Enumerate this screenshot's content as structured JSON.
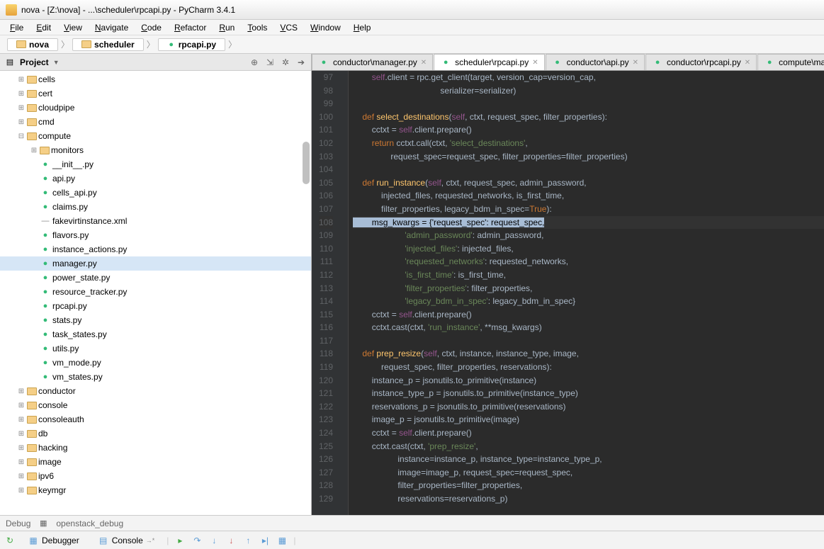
{
  "title": "nova - [Z:\\nova] - ...\\scheduler\\rpcapi.py - PyCharm 3.4.1",
  "menus": [
    "File",
    "Edit",
    "View",
    "Navigate",
    "Code",
    "Refactor",
    "Run",
    "Tools",
    "VCS",
    "Window",
    "Help"
  ],
  "crumbs": [
    {
      "icon": "dir",
      "label": "nova"
    },
    {
      "icon": "dir",
      "label": "scheduler"
    },
    {
      "icon": "py",
      "label": "rpcapi.py"
    }
  ],
  "project_label": "Project",
  "tree": [
    {
      "d": 1,
      "t": "dir",
      "tw": "+",
      "n": "cells"
    },
    {
      "d": 1,
      "t": "dir",
      "tw": "+",
      "n": "cert"
    },
    {
      "d": 1,
      "t": "dir",
      "tw": "+",
      "n": "cloudpipe"
    },
    {
      "d": 1,
      "t": "dir",
      "tw": "+",
      "n": "cmd"
    },
    {
      "d": 1,
      "t": "dir",
      "tw": "-",
      "n": "compute"
    },
    {
      "d": 2,
      "t": "dir",
      "tw": "+",
      "n": "monitors"
    },
    {
      "d": 2,
      "t": "py",
      "tw": "",
      "n": "__init__.py"
    },
    {
      "d": 2,
      "t": "py",
      "tw": "",
      "n": "api.py"
    },
    {
      "d": 2,
      "t": "py",
      "tw": "",
      "n": "cells_api.py"
    },
    {
      "d": 2,
      "t": "py",
      "tw": "",
      "n": "claims.py"
    },
    {
      "d": 2,
      "t": "xml",
      "tw": "",
      "n": "fakevirtinstance.xml"
    },
    {
      "d": 2,
      "t": "py",
      "tw": "",
      "n": "flavors.py"
    },
    {
      "d": 2,
      "t": "py",
      "tw": "",
      "n": "instance_actions.py"
    },
    {
      "d": 2,
      "t": "py",
      "tw": "",
      "n": "manager.py",
      "sel": true
    },
    {
      "d": 2,
      "t": "py",
      "tw": "",
      "n": "power_state.py"
    },
    {
      "d": 2,
      "t": "py",
      "tw": "",
      "n": "resource_tracker.py"
    },
    {
      "d": 2,
      "t": "py",
      "tw": "",
      "n": "rpcapi.py"
    },
    {
      "d": 2,
      "t": "py",
      "tw": "",
      "n": "stats.py"
    },
    {
      "d": 2,
      "t": "py",
      "tw": "",
      "n": "task_states.py"
    },
    {
      "d": 2,
      "t": "py",
      "tw": "",
      "n": "utils.py"
    },
    {
      "d": 2,
      "t": "py",
      "tw": "",
      "n": "vm_mode.py"
    },
    {
      "d": 2,
      "t": "py",
      "tw": "",
      "n": "vm_states.py"
    },
    {
      "d": 1,
      "t": "dir",
      "tw": "+",
      "n": "conductor"
    },
    {
      "d": 1,
      "t": "dir",
      "tw": "+",
      "n": "console"
    },
    {
      "d": 1,
      "t": "dir",
      "tw": "+",
      "n": "consoleauth"
    },
    {
      "d": 1,
      "t": "dir",
      "tw": "+",
      "n": "db"
    },
    {
      "d": 1,
      "t": "dir",
      "tw": "+",
      "n": "hacking"
    },
    {
      "d": 1,
      "t": "dir",
      "tw": "+",
      "n": "image"
    },
    {
      "d": 1,
      "t": "dir",
      "tw": "+",
      "n": "ipv6"
    },
    {
      "d": 1,
      "t": "dir",
      "tw": "+",
      "n": "keymgr"
    }
  ],
  "tabs": [
    {
      "label": "conductor\\manager.py"
    },
    {
      "label": "scheduler\\rpcapi.py",
      "active": true
    },
    {
      "label": "conductor\\api.py"
    },
    {
      "label": "conductor\\rpcapi.py"
    },
    {
      "label": "compute\\ma"
    }
  ],
  "first_line": 97,
  "highlight_line": 108,
  "code": [
    [
      [
        "",
        "        "
      ],
      [
        "sf",
        "self"
      ],
      [
        "op",
        ".client "
      ],
      [
        "op",
        "= "
      ],
      [
        "",
        "rpc.get_client(target"
      ],
      [
        "op",
        ", "
      ],
      [
        "",
        "version_cap"
      ],
      [
        "op",
        "="
      ],
      [
        "",
        "version_cap"
      ],
      [
        "op",
        ","
      ]
    ],
    [
      [
        "",
        "                                     serializer"
      ],
      [
        "op",
        "="
      ],
      [
        "",
        "serializer)"
      ]
    ],
    [],
    [
      [
        "",
        "    "
      ],
      [
        "kw",
        "def "
      ],
      [
        "fn",
        "select_destinations"
      ],
      [
        "",
        "("
      ],
      [
        "sf",
        "self"
      ],
      [
        "op",
        ", "
      ],
      [
        "",
        "ctxt"
      ],
      [
        "op",
        ", "
      ],
      [
        "",
        "request_spec"
      ],
      [
        "op",
        ", "
      ],
      [
        "",
        "filter_properties):"
      ]
    ],
    [
      [
        "",
        "        cctxt "
      ],
      [
        "op",
        "= "
      ],
      [
        "sf",
        "self"
      ],
      [
        "",
        ".client.prepare()"
      ]
    ],
    [
      [
        "",
        "        "
      ],
      [
        "kw",
        "return "
      ],
      [
        "",
        "cctxt.call(ctxt"
      ],
      [
        "op",
        ", "
      ],
      [
        "str",
        "'select_destinations'"
      ],
      [
        "op",
        ","
      ]
    ],
    [
      [
        "",
        "                request_spec"
      ],
      [
        "op",
        "="
      ],
      [
        "",
        "request_spec"
      ],
      [
        "op",
        ", "
      ],
      [
        "",
        "filter_properties"
      ],
      [
        "op",
        "="
      ],
      [
        "",
        "filter_properties)"
      ]
    ],
    [],
    [
      [
        "",
        "    "
      ],
      [
        "kw",
        "def "
      ],
      [
        "fn",
        "run_instance"
      ],
      [
        "",
        "("
      ],
      [
        "sf",
        "self"
      ],
      [
        "op",
        ", "
      ],
      [
        "",
        "ctxt"
      ],
      [
        "op",
        ", "
      ],
      [
        "",
        "request_spec"
      ],
      [
        "op",
        ", "
      ],
      [
        "",
        "admin_password"
      ],
      [
        "op",
        ","
      ]
    ],
    [
      [
        "",
        "            injected_files"
      ],
      [
        "op",
        ", "
      ],
      [
        "",
        "requested_networks"
      ],
      [
        "op",
        ", "
      ],
      [
        "",
        "is_first_time"
      ],
      [
        "op",
        ","
      ]
    ],
    [
      [
        "",
        "            filter_properties"
      ],
      [
        "op",
        ", "
      ],
      [
        "",
        "legacy_bdm_in_spec"
      ],
      [
        "op",
        "="
      ],
      [
        "kw",
        "True"
      ],
      [
        "",
        "):"
      ]
    ],
    [
      [
        "cursel",
        "        msg_kwargs = {'request_spec': request_spec,"
      ]
    ],
    [
      [
        "",
        "                      "
      ],
      [
        "str",
        "'admin_password'"
      ],
      [
        "",
        ": admin_password"
      ],
      [
        "op",
        ","
      ]
    ],
    [
      [
        "",
        "                      "
      ],
      [
        "str",
        "'injected_files'"
      ],
      [
        "",
        ": injected_files"
      ],
      [
        "op",
        ","
      ]
    ],
    [
      [
        "",
        "                      "
      ],
      [
        "str",
        "'requested_networks'"
      ],
      [
        "",
        ": requested_networks"
      ],
      [
        "op",
        ","
      ]
    ],
    [
      [
        "",
        "                      "
      ],
      [
        "str",
        "'is_first_time'"
      ],
      [
        "",
        ": is_first_time"
      ],
      [
        "op",
        ","
      ]
    ],
    [
      [
        "",
        "                      "
      ],
      [
        "str",
        "'filter_properties'"
      ],
      [
        "",
        ": filter_properties"
      ],
      [
        "op",
        ","
      ]
    ],
    [
      [
        "",
        "                      "
      ],
      [
        "str",
        "'legacy_bdm_in_spec'"
      ],
      [
        "",
        ": legacy_bdm_in_spec}"
      ]
    ],
    [
      [
        "",
        "        cctxt "
      ],
      [
        "op",
        "= "
      ],
      [
        "sf",
        "self"
      ],
      [
        "",
        ".client.prepare()"
      ]
    ],
    [
      [
        "",
        "        cctxt.cast(ctxt"
      ],
      [
        "op",
        ", "
      ],
      [
        "str",
        "'run_instance'"
      ],
      [
        "op",
        ", "
      ],
      [
        "op",
        "**"
      ],
      [
        "",
        "msg_kwargs)"
      ]
    ],
    [],
    [
      [
        "",
        "    "
      ],
      [
        "kw",
        "def "
      ],
      [
        "fn",
        "prep_resize"
      ],
      [
        "",
        "("
      ],
      [
        "sf",
        "self"
      ],
      [
        "op",
        ", "
      ],
      [
        "",
        "ctxt"
      ],
      [
        "op",
        ", "
      ],
      [
        "",
        "instance"
      ],
      [
        "op",
        ", "
      ],
      [
        "",
        "instance_type"
      ],
      [
        "op",
        ", "
      ],
      [
        "",
        "image"
      ],
      [
        "op",
        ","
      ]
    ],
    [
      [
        "",
        "            request_spec"
      ],
      [
        "op",
        ", "
      ],
      [
        "",
        "filter_properties"
      ],
      [
        "op",
        ", "
      ],
      [
        "",
        "reservations):"
      ]
    ],
    [
      [
        "",
        "        instance_p "
      ],
      [
        "op",
        "= "
      ],
      [
        "",
        "jsonutils.to_primitive(instance)"
      ]
    ],
    [
      [
        "",
        "        instance_type_p "
      ],
      [
        "op",
        "= "
      ],
      [
        "",
        "jsonutils.to_primitive(instance_type)"
      ]
    ],
    [
      [
        "",
        "        reservations_p "
      ],
      [
        "op",
        "= "
      ],
      [
        "",
        "jsonutils.to_primitive(reservations)"
      ]
    ],
    [
      [
        "",
        "        image_p "
      ],
      [
        "op",
        "= "
      ],
      [
        "",
        "jsonutils.to_primitive(image)"
      ]
    ],
    [
      [
        "",
        "        cctxt "
      ],
      [
        "op",
        "= "
      ],
      [
        "sf",
        "self"
      ],
      [
        "",
        ".client.prepare()"
      ]
    ],
    [
      [
        "",
        "        cctxt.cast(ctxt"
      ],
      [
        "op",
        ", "
      ],
      [
        "str",
        "'prep_resize'"
      ],
      [
        "op",
        ","
      ]
    ],
    [
      [
        "",
        "                   instance"
      ],
      [
        "op",
        "="
      ],
      [
        "",
        "instance_p"
      ],
      [
        "op",
        ", "
      ],
      [
        "",
        "instance_type"
      ],
      [
        "op",
        "="
      ],
      [
        "",
        "instance_type_p"
      ],
      [
        "op",
        ","
      ]
    ],
    [
      [
        "",
        "                   image"
      ],
      [
        "op",
        "="
      ],
      [
        "",
        "image_p"
      ],
      [
        "op",
        ", "
      ],
      [
        "",
        "request_spec"
      ],
      [
        "op",
        "="
      ],
      [
        "",
        "request_spec"
      ],
      [
        "op",
        ","
      ]
    ],
    [
      [
        "",
        "                   filter_properties"
      ],
      [
        "op",
        "="
      ],
      [
        "",
        "filter_properties"
      ],
      [
        "op",
        ","
      ]
    ],
    [
      [
        "",
        "                   reservations"
      ],
      [
        "op",
        "="
      ],
      [
        "",
        "reservations_p)"
      ]
    ]
  ],
  "status": {
    "debug": "Debug",
    "cfg": "openstack_debug"
  },
  "dbg": {
    "debugger": "Debugger",
    "console": "Console"
  }
}
